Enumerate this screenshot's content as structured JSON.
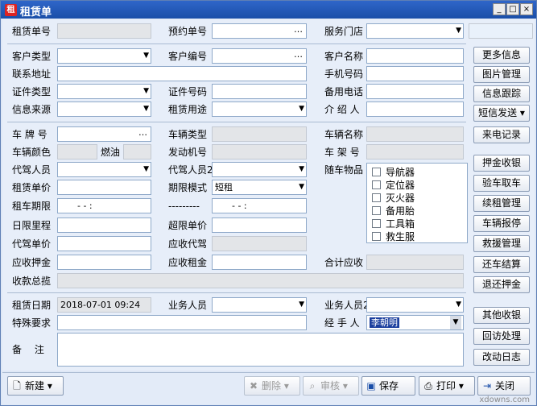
{
  "window": {
    "title": "租赁单",
    "icon_char": "租",
    "minimize": "_",
    "maximize": "□",
    "close": "×"
  },
  "labels": {
    "order_no": "租赁单号",
    "booking_no": "预约单号",
    "store": "服务门店",
    "cust_type": "客户类型",
    "cust_no": "客户编号",
    "cust_name": "客户名称",
    "address": "联系地址",
    "mobile": "手机号码",
    "id_type": "证件类型",
    "id_no": "证件号码",
    "alt_phone": "备用电话",
    "info_source": "信息来源",
    "rent_use": "租赁用途",
    "referrer": "介 绍 人",
    "plate": "车 牌 号",
    "car_type": "车辆类型",
    "car_name": "车辆名称",
    "car_color": "车辆颜色",
    "fuel": "燃油",
    "engine_no": "发动机号",
    "frame_no": "车 架 号",
    "driver": "代驾人员",
    "driver2": "代驾人员2",
    "accessories": "随车物品",
    "unit_price": "租赁单价",
    "term_mode": "期限模式",
    "rent_period": "租车期限",
    "dashes": "---------",
    "daily_km": "日限里程",
    "excess_price": "超限单价",
    "driver_price": "代驾单价",
    "recv_driver": "应收代驾",
    "recv_deposit": "应收押金",
    "recv_rent": "应收租金",
    "total_recv": "合计应收",
    "collect_summary": "收款总揽",
    "rent_date": "租赁日期",
    "sales": "业务人员",
    "sales2": "业务人员2",
    "special": "特殊要求",
    "handler": "经 手 人",
    "remark": "备    注"
  },
  "values": {
    "rent_period_from": "-  -      :",
    "rent_period_to": "-  -      :",
    "term_mode": "短租",
    "rent_date": "2018-07-01 09:24",
    "handler": "李朝明"
  },
  "accessories": [
    "导航器",
    "定位器",
    "灭火器",
    "备用胎",
    "工具箱",
    "救生服"
  ],
  "side_buttons": [
    "更多信息",
    "图片管理",
    "信息跟踪",
    "短信发送 ▾",
    "来电记录",
    "押金收银",
    "验车取车",
    "续租管理",
    "车辆报停",
    "救援管理",
    "还车结算",
    "退还押金",
    "其他收银",
    "回访处理",
    "改动日志"
  ],
  "toolbar": {
    "new": "新建",
    "delete": "删除",
    "audit": "审核",
    "save": "保存",
    "print": "打印",
    "close": "关闭"
  },
  "watermark": "xdowns.com"
}
